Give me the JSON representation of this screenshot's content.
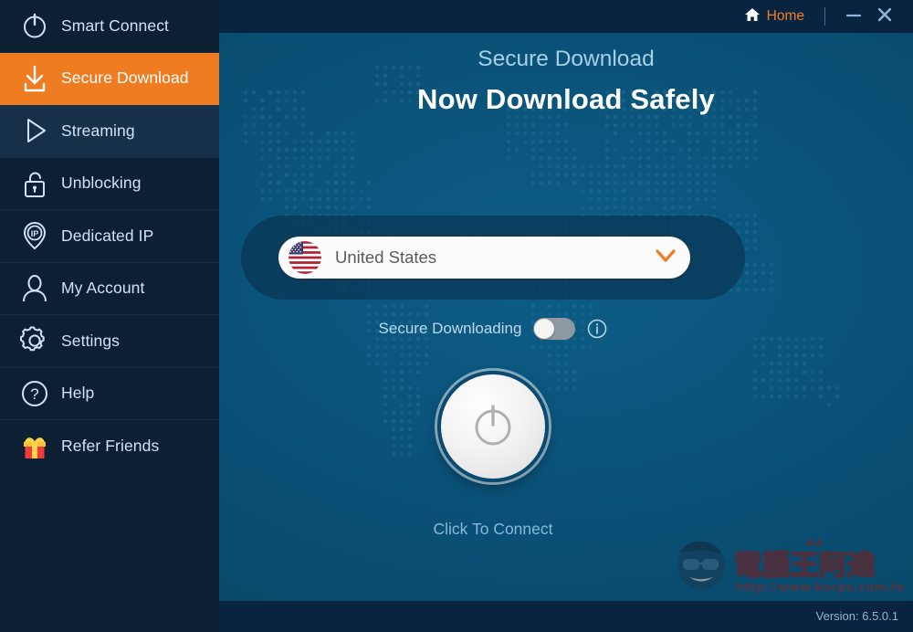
{
  "window": {
    "titlebar": {
      "home_label": "Home",
      "home_icon": "house-icon",
      "minimize_icon": "minimize-icon",
      "close_icon": "close-icon"
    },
    "footer": {
      "version_text": "Version: 6.5.0.1"
    }
  },
  "sidebar": {
    "items": [
      {
        "label": "Smart Connect",
        "icon": "power-icon",
        "state": "normal"
      },
      {
        "label": "Secure Download",
        "icon": "download-icon",
        "state": "active"
      },
      {
        "label": "Streaming",
        "icon": "play-icon",
        "state": "hover"
      },
      {
        "label": "Unblocking",
        "icon": "lock-icon",
        "state": "normal"
      },
      {
        "label": "Dedicated IP",
        "icon": "ip-pin-icon",
        "state": "normal"
      },
      {
        "label": "My Account",
        "icon": "user-icon",
        "state": "normal"
      },
      {
        "label": "Settings",
        "icon": "gear-icon",
        "state": "normal"
      },
      {
        "label": "Help",
        "icon": "question-icon",
        "state": "normal"
      },
      {
        "label": "Refer Friends",
        "icon": "gift-icon",
        "state": "normal"
      }
    ]
  },
  "main": {
    "subtitle": "Secure Download",
    "headline": "Now Download Safely",
    "country_select": {
      "value": "United States",
      "flag": "flag-us-icon",
      "chevron_icon": "chevron-down-icon"
    },
    "secure_downloading": {
      "label": "Secure Downloading",
      "toggle_state": "off",
      "info_icon": "info-icon"
    },
    "power_button": {
      "icon": "power-icon",
      "state": "disconnected"
    },
    "connect_label": "Click To Connect"
  },
  "watermark": {
    "text": "電腦王阿達",
    "url": "http://www.kocpc.com.tw"
  },
  "colors": {
    "accent_orange": "#f07c22",
    "sidebar_bg": "#0d2033",
    "main_bg": "#0a5178",
    "titlebar_bg": "#082440",
    "label_blue": "#cfe3f5"
  }
}
